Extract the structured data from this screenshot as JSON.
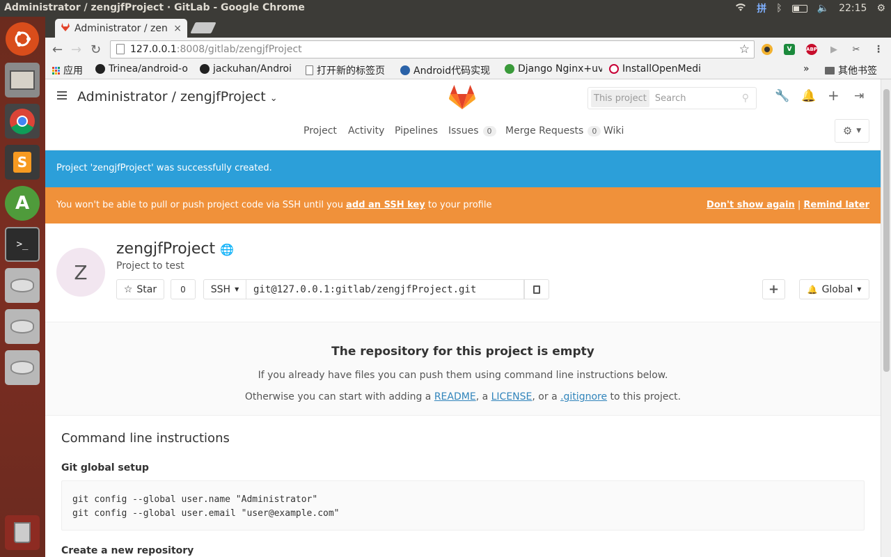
{
  "os": {
    "window_title": "Administrator / zengjfProject · GitLab - Google Chrome",
    "input_method": "拼",
    "clock": "22:15"
  },
  "browser": {
    "tab_title": "Administrator / zen",
    "url_host": "127.0.0.1",
    "url_path": ":8008/gitlab/zengjfProject",
    "bookmarks": [
      {
        "label": "应用",
        "icon": "apps-icon"
      },
      {
        "label": "Trinea/android-o",
        "icon": "github-icon"
      },
      {
        "label": "jackuhan/Androi",
        "icon": "github-icon"
      },
      {
        "label": "打开新的标签页",
        "icon": "page-icon"
      },
      {
        "label": "Android代码实现",
        "icon": "site-icon"
      },
      {
        "label": "Django Nginx+uv",
        "icon": "site-icon"
      },
      {
        "label": "InstallOpenMedi",
        "icon": "debian-icon"
      }
    ],
    "bookmarks_overflow": "»",
    "other_bookmarks": "其他书签",
    "extensions": [
      {
        "label": "V",
        "color": "#1b8a3c"
      },
      {
        "label": "ABP",
        "color": "#c70d2c"
      }
    ]
  },
  "gitlab": {
    "breadcrumb": "Administrator / zengjfProject",
    "search": {
      "scope": "This project",
      "placeholder": "Search"
    },
    "nav": [
      {
        "label": "Project"
      },
      {
        "label": "Activity"
      },
      {
        "label": "Pipelines"
      },
      {
        "label": "Issues",
        "count": "0"
      },
      {
        "label": "Merge Requests",
        "count": "0"
      },
      {
        "label": "Wiki"
      }
    ],
    "flash_notice": "Project 'zengjfProject' was successfully created.",
    "ssh_warning": {
      "before": "You won't be able to pull or push project code via SSH until you ",
      "link": "add an SSH key",
      "after": " to your profile",
      "dont_show": "Don't show again",
      "sep": " | ",
      "remind": "Remind later"
    },
    "project": {
      "avatar_letter": "Z",
      "name": "zengjfProject",
      "description": "Project to test",
      "star_label": "Star",
      "star_count": "0",
      "protocol": "SSH",
      "clone_url": "git@127.0.0.1:gitlab/zengjfProject.git",
      "add_label": "+",
      "notification": "Global"
    },
    "empty": {
      "title": "The repository for this project is empty",
      "line1": "If you already have files you can push them using command line instructions below.",
      "line2_before": "Otherwise you can start with adding a ",
      "readme": "README",
      "sep1": ", a ",
      "license": "LICENSE",
      "sep2": ", or a ",
      "gitignore": ".gitignore",
      "line2_after": " to this project."
    },
    "cli": {
      "title": "Command line instructions",
      "global_setup": "Git global setup",
      "global_code": "git config --global user.name \"Administrator\"\ngit config --global user.email \"user@example.com\"",
      "new_repo": "Create a new repository"
    }
  }
}
